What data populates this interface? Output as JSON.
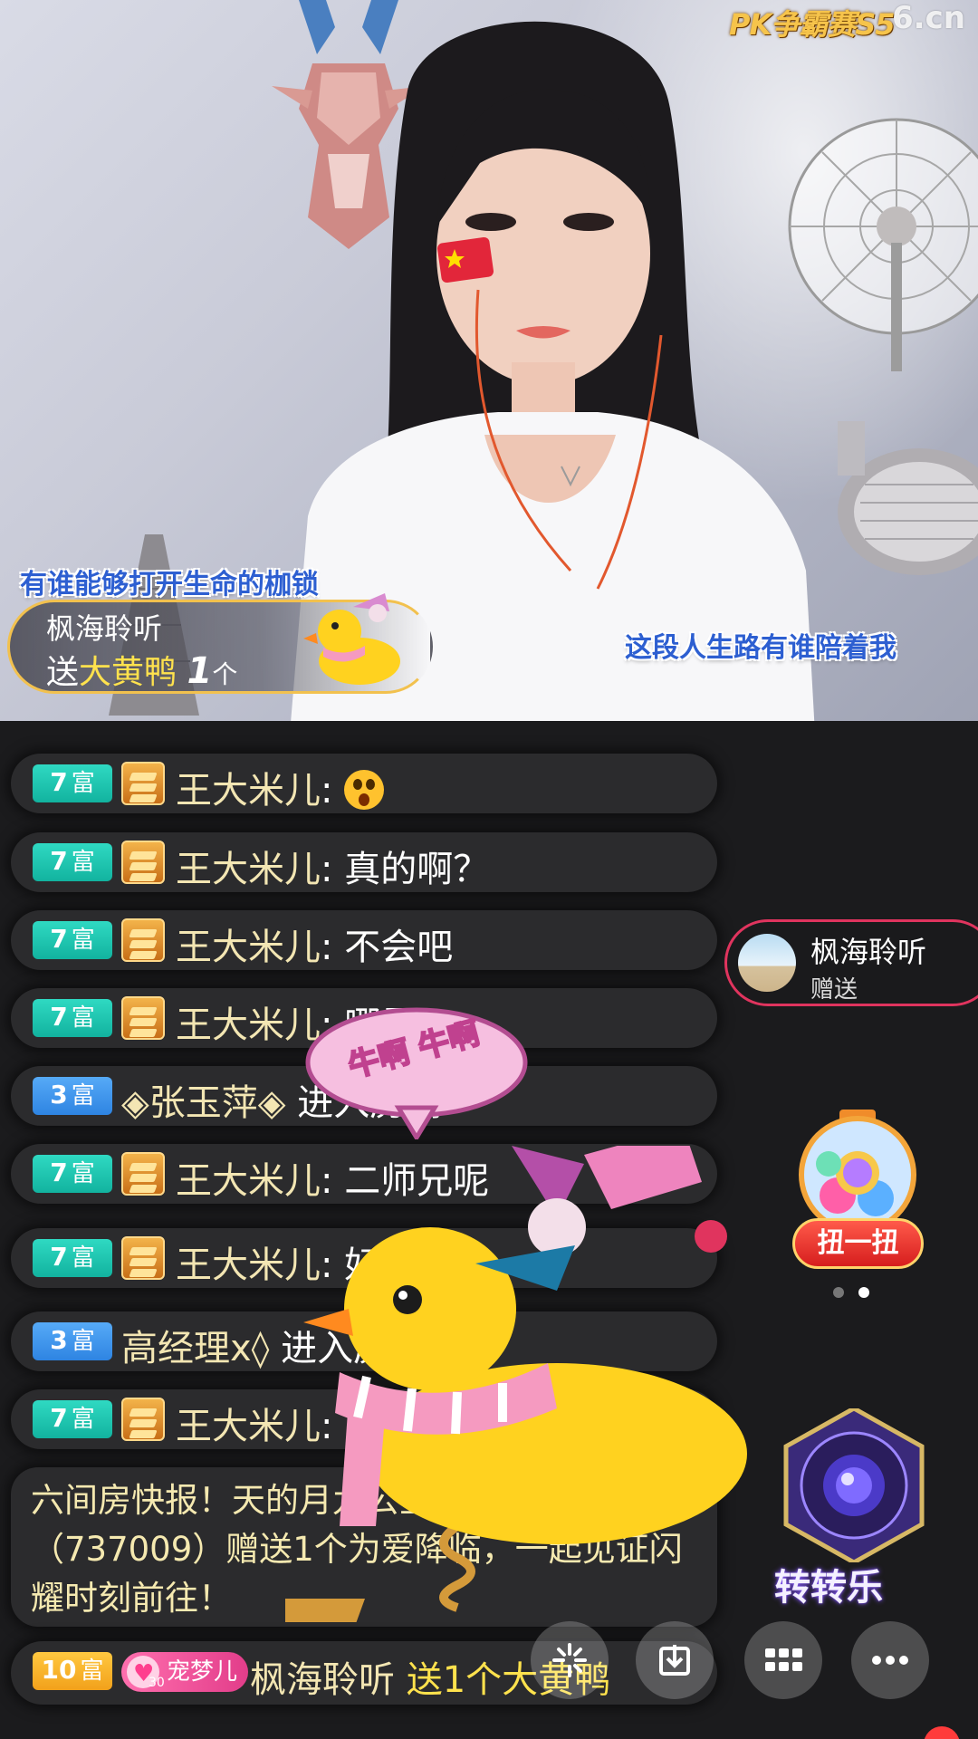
{
  "stream": {
    "pk_logo": "PK争霸赛S5",
    "site_logo": "6.cn",
    "lyric_left": "有谁能够打开生命的枷锁",
    "lyric_right": "这段人生路有谁陪着我"
  },
  "gift_notice": {
    "user": "枫海聆听",
    "verb": "送",
    "gift_name": "大黄鸭",
    "count": "1",
    "unit": "个"
  },
  "chat": [
    {
      "level": "7",
      "tier": "富",
      "color": "#1fc7b1",
      "name": "王大米儿",
      "sep": ":",
      "text": "",
      "emoji": "surprised-face"
    },
    {
      "level": "7",
      "tier": "富",
      "color": "#1fc7b1",
      "name": "王大米儿",
      "sep": ":",
      "text": "真的啊？"
    },
    {
      "level": "7",
      "tier": "富",
      "color": "#1fc7b1",
      "name": "王大米儿",
      "sep": ":",
      "text": "不会吧"
    },
    {
      "level": "7",
      "tier": "富",
      "color": "#1fc7b1",
      "name": "王大米儿",
      "sep": ":",
      "text": "哪里"
    },
    {
      "level": "3",
      "tier": "富",
      "color": "#3d94ec",
      "name": "◈张玉萍◈",
      "sep": "",
      "text": "进入房间"
    },
    {
      "level": "7",
      "tier": "富",
      "color": "#1fc7b1",
      "name": "王大米儿",
      "sep": ":",
      "text": "二师兄呢"
    },
    {
      "level": "7",
      "tier": "富",
      "color": "#1fc7b1",
      "name": "王大米儿",
      "sep": ":",
      "text": "好久"
    },
    {
      "level": "3",
      "tier": "富",
      "color": "#3d94ec",
      "name": "高经理x◊",
      "sep": "",
      "text": "进入房间"
    },
    {
      "level": "7",
      "tier": "富",
      "color": "#1fc7b1",
      "name": "王大米儿",
      "sep": ":",
      "text": ""
    }
  ],
  "news": "六间房快报！天的月九公主要升21冠啦（737009）赠送1个为爱降临，一起见证闪耀时刻前往！",
  "send_row": {
    "level": "10",
    "tier": "富",
    "fan_badge": "宠梦儿",
    "fan_level": "30",
    "user": "枫海聆听",
    "action": "送1个大黄鸭"
  },
  "gift_popup": {
    "user": "枫海聆听",
    "action": "赠送"
  },
  "bubble_text": "牛啊 牛啊",
  "side": {
    "gacha_label": "扭一扭",
    "wheel_label": "转转乐"
  },
  "toolbar": [
    "sparkle-icon",
    "download-icon",
    "grid-icon",
    "more-icon"
  ],
  "colors": {
    "accent_gold": "#f2c14e",
    "accent_red": "#e0345e",
    "chat_bg": "#2b2b2d"
  }
}
